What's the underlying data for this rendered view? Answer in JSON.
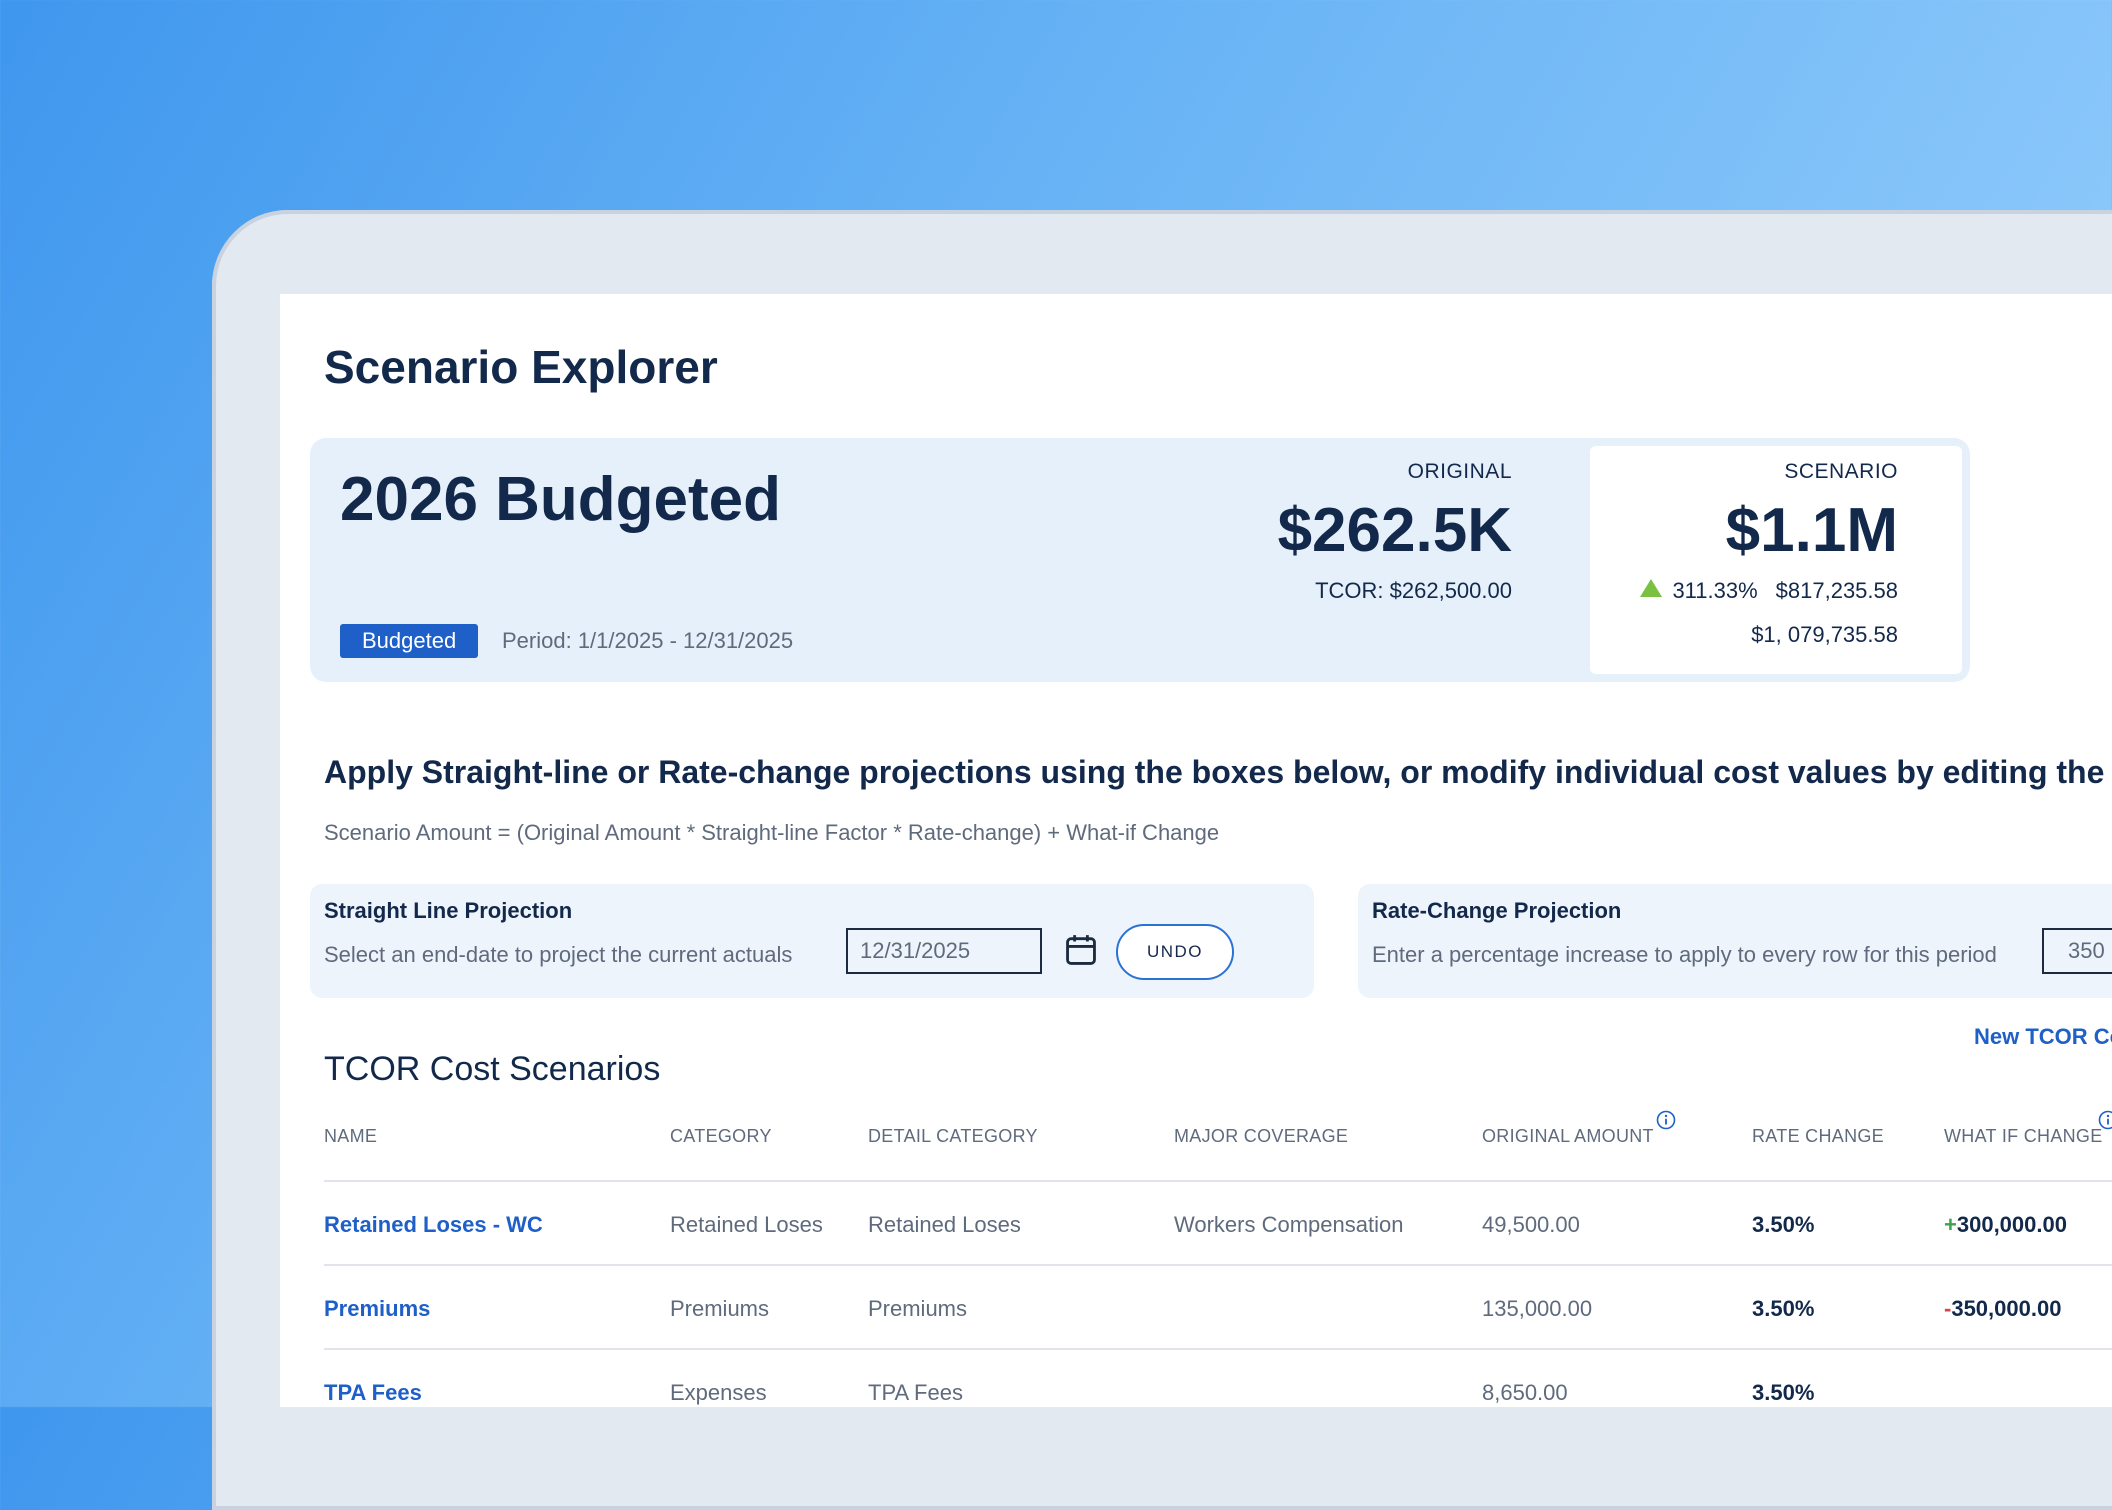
{
  "page": {
    "title": "Scenario Explorer"
  },
  "summary": {
    "name": "2026 Budgeted",
    "badge": "Budgeted",
    "period": "Period: 1/1/2025 - 12/31/2025",
    "original": {
      "label": "ORIGINAL",
      "amount": "$262.5K",
      "tcor": "TCOR: $262,500.00"
    },
    "scenario": {
      "label": "SCENARIO",
      "amount": "$1.1M",
      "change_pct": "311.33%",
      "change_amount": "$817,235.58",
      "total": "$1, 079,735.58",
      "trend_icon": "up-triangle-icon"
    }
  },
  "instructions": {
    "text": "Apply Straight-line or Rate-change projections using the boxes below, or modify individual cost values by editing the",
    "formula": "Scenario Amount = (Original Amount * Straight-line Factor * Rate-change) + What-if Change"
  },
  "straight_line": {
    "title": "Straight Line Projection",
    "description": "Select an end-date to project the current actuals",
    "date_value": "12/31/2025",
    "calendar_icon": "calendar-icon",
    "undo_label": "UNDO"
  },
  "rate_change": {
    "title": "Rate-Change Projection",
    "description": "Enter a percentage increase to apply to every row for this period",
    "value": "350"
  },
  "table": {
    "title": "TCOR Cost Scenarios",
    "new_link": "New TCOR Co",
    "columns": [
      "NAME",
      "CATEGORY",
      "DETAIL CATEGORY",
      "MAJOR COVERAGE",
      "ORIGINAL AMOUNT",
      "RATE CHANGE",
      "WHAT IF CHANGE"
    ],
    "rows": [
      {
        "name": "Retained Loses - WC",
        "category": "Retained Loses",
        "detail": "Retained Loses",
        "coverage": "Workers Compensation",
        "original": "49,500.00",
        "rate": "3.50%",
        "whatif_sign": "+",
        "whatif_value": "300,000.00"
      },
      {
        "name": "Premiums",
        "category": "Premiums",
        "detail": "Premiums",
        "coverage": "",
        "original": "135,000.00",
        "rate": "3.50%",
        "whatif_sign": "-",
        "whatif_value": "350,000.00"
      },
      {
        "name": "TPA Fees",
        "category": "Expenses",
        "detail": "TPA Fees",
        "coverage": "",
        "original": "8,650.00",
        "rate": "3.50%",
        "whatif_sign": "",
        "whatif_value": ""
      }
    ]
  },
  "colors": {
    "accent": "#1e5fc8",
    "positive": "#3aa351",
    "negative": "#d94545",
    "trend_up": "#7ac142",
    "summary_bg": "#e6f0fb"
  }
}
